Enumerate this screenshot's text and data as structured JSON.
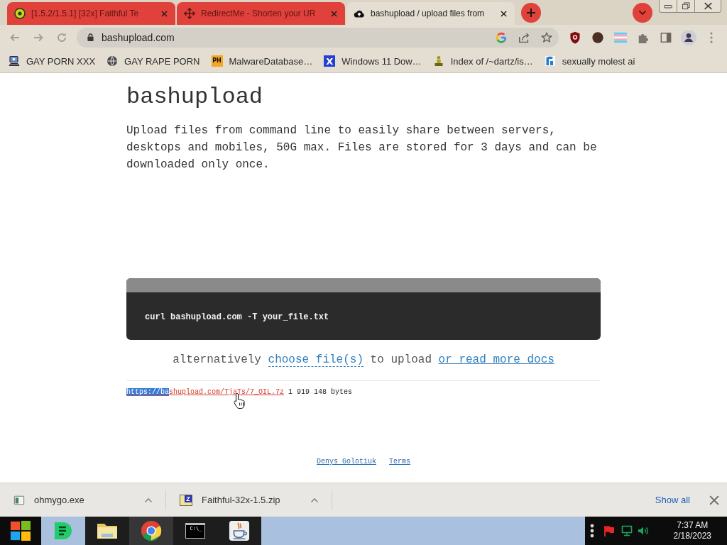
{
  "browser": {
    "tabs": [
      {
        "title": "[1.5.2/1.5.1] [32x] Faithful Te",
        "selected": false
      },
      {
        "title": "RedirectMe - Shorten your UR",
        "selected": false
      },
      {
        "title": "bashupload / upload files from",
        "selected": true
      }
    ],
    "address": "bashupload.com",
    "bookmarks": [
      {
        "label": "GAY PORN XXX"
      },
      {
        "label": "GAY RAPE PORN"
      },
      {
        "label": "MalwareDatabase…",
        "badge": "PH",
        "color": "#f5a623"
      },
      {
        "label": "Windows 11 Dow…",
        "badge": "X",
        "color": "#2340d0"
      },
      {
        "label": "Index of /~dartz/is…"
      },
      {
        "label": "sexually molest ai"
      }
    ]
  },
  "page": {
    "title": "bashupload",
    "intro": "Upload files from command line to easily share between servers, desktops and mobiles, 50G max. Files are stored for 3 days and can be downloaded only once.",
    "command": "curl bashupload.com -T your_file.txt",
    "alternative": {
      "before": "alternatively",
      "choose_link": "choose file(s)",
      "between": "to upload",
      "docs_link": "or read more docs"
    },
    "result": {
      "link_selected": "https://ba",
      "link_rest": "shupload.com/TjaTs/7_OIL.7z",
      "size": "1 919 148 bytes"
    },
    "footer_links": [
      "Denys Golotiuk",
      "Terms"
    ]
  },
  "downloads": {
    "items": [
      {
        "name": "ohmygo.exe"
      },
      {
        "name": "Faithful-32x-1.5.zip",
        "badge": "Z"
      }
    ],
    "show_all": "Show all"
  },
  "taskbar": {
    "apps": [
      {
        "open": false,
        "selected": false
      },
      {
        "open": true,
        "selected": false
      },
      {
        "open": true,
        "selected": true
      },
      {
        "glyph": "C:\\_",
        "open": true,
        "selected": false
      },
      {
        "open": true,
        "selected": false
      }
    ],
    "clock": {
      "time": "7:37 AM",
      "date": "2/18/2023"
    }
  }
}
